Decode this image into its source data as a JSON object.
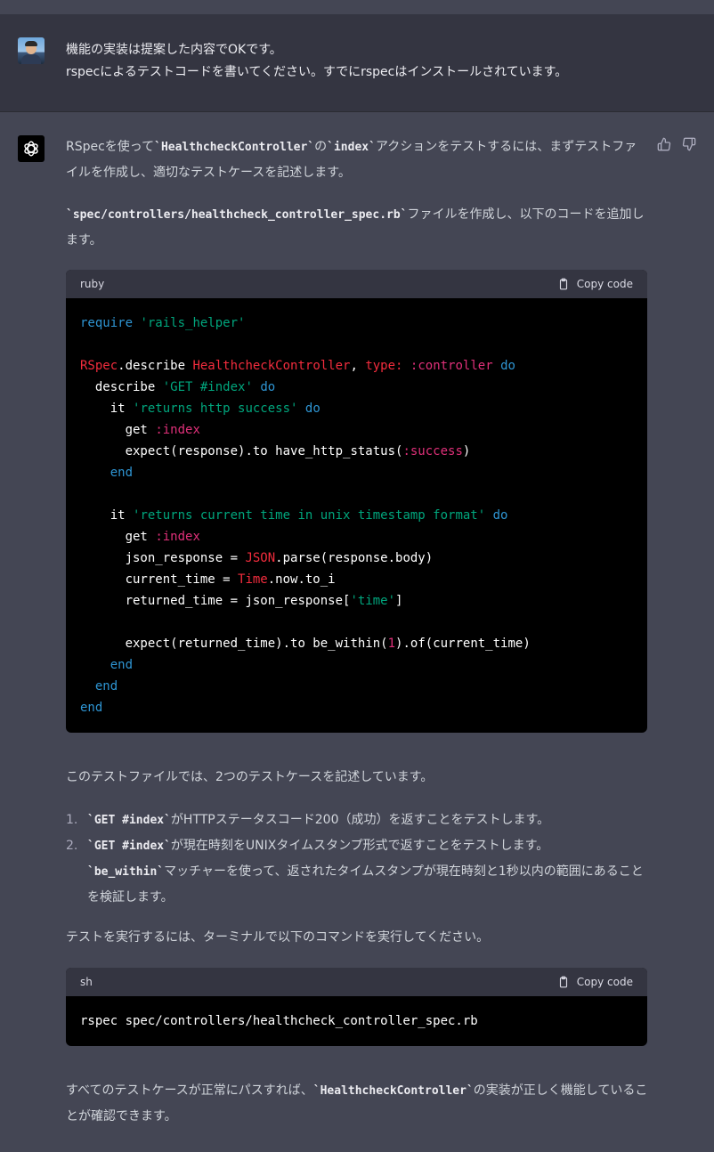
{
  "user_message": {
    "line1": "機能の実装は提案した内容でOKです。",
    "line2": "rspecによるテストコードを書いてください。すでにrspecはインストールされています。"
  },
  "assistant": {
    "intro": {
      "a": "RSpecを使って",
      "b": "`HealthcheckController`",
      "c": "の",
      "d": "`index`",
      "e": "アクションをテストするには、まずテストファイルを作成し、適切なテストケースを記述します。"
    },
    "file_para": {
      "a": "`spec/controllers/healthcheck_controller_spec.rb`",
      "b": "ファイルを作成し、以下のコードを追加します。"
    },
    "code1": {
      "lang": "ruby",
      "copy_label": "Copy code",
      "lines": {
        "l1_require": "require",
        "l1_str": "'rails_helper'",
        "l3_rspec": "RSpec",
        "l3_describe": ".describe ",
        "l3_class": "HealthcheckController",
        "l3_comma": ", ",
        "l3_type": "type:",
        "l3_sym": " :controller",
        "l3_do": "do",
        "l4_describe": "describe",
        "l4_str": "'GET #index'",
        "l4_do": "do",
        "l5_it": "it",
        "l5_str": "'returns http success'",
        "l5_do": "do",
        "l6_get": "get",
        "l6_sym": ":index",
        "l7_a": "expect(response).to have_http_status(",
        "l7_sym": ":success",
        "l7_b": ")",
        "l8_end": "end",
        "l10_it": "it",
        "l10_str": "'returns current time in unix timestamp format'",
        "l10_do": "do",
        "l11_get": "get",
        "l11_sym": ":index",
        "l12_a": "json_response = ",
        "l12_const": "JSON",
        "l12_b": ".parse(response.body)",
        "l13_a": "current_time = ",
        "l13_const": "Time",
        "l13_b": ".now.to_i",
        "l14_a": "returned_time = json_response[",
        "l14_str": "'time'",
        "l14_b": "]",
        "l16_a": "expect(returned_time).to be_within(",
        "l16_num": "1",
        "l16_b": ").of(current_time)",
        "l17_end": "end",
        "l18_end": "end",
        "l19_end": "end"
      }
    },
    "summary": "このテストファイルでは、2つのテストケースを記述しています。",
    "list": [
      {
        "num": "1.",
        "code": "`GET #index`",
        "text": "がHTTPステータスコード200（成功）を返すことをテストします。"
      },
      {
        "num": "2.",
        "code": "`GET #index`",
        "text": "が現在時刻をUNIXタイムスタンプ形式で返すことをテストします。",
        "code2": "`be_within`",
        "text2": "マッチャーを使って、返されたタイムスタンプが現在時刻と1秒以内の範囲にあることを検証します。"
      }
    ],
    "run_para": "テストを実行するには、ターミナルで以下のコマンドを実行してください。",
    "code2": {
      "lang": "sh",
      "copy_label": "Copy code",
      "command": "rspec spec/controllers/healthcheck_controller_spec.rb"
    },
    "final": {
      "a": "すべてのテストケースが正常にパスすれば、",
      "b": "`HealthcheckController`",
      "c": "の実装が正しく機能していることが確認できます。"
    }
  },
  "icons": {
    "avatar": "user-avatar",
    "assistant": "openai-logo-icon",
    "copy": "clipboard-icon",
    "like": "thumbs-up-icon",
    "dislike": "thumbs-down-icon"
  },
  "colors": {
    "page_bg": "#444654",
    "user_bg": "#343541",
    "code_bg": "#000000",
    "code_header": "#343541",
    "keyword": "#2e95d3",
    "string": "#00a67d",
    "class": "#f22c3d",
    "symbol": "#df3079"
  }
}
